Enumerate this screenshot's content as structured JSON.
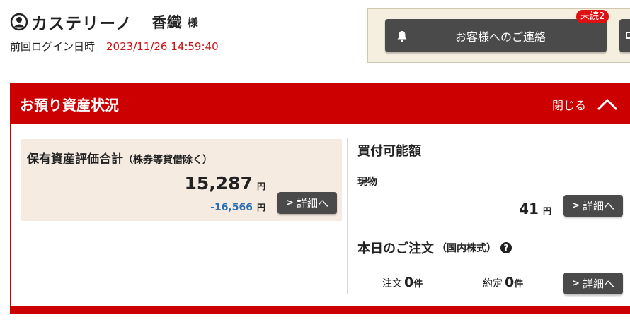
{
  "user": {
    "name": "カステリーノ",
    "given_name": "香織",
    "honorific": "様",
    "last_login_label": "前回ログイン日時",
    "last_login_time": "2023/11/26 14:59:40"
  },
  "contact": {
    "button_label": "お客様へのご連絡",
    "unread_badge": "未読2",
    "icon": "bell-icon"
  },
  "assets": {
    "title": "お預り資産状況",
    "close_label": "閉じる",
    "holdings": {
      "title": "保有資産評価合計",
      "note": "（株券等貸借除く）",
      "value": "15,287",
      "unit": "円",
      "diff": "-16,566",
      "diff_unit": "円",
      "detail_label": "詳細へ"
    },
    "buying_power": {
      "title": "買付可能額",
      "cash_label": "現物",
      "value": "41",
      "unit": "円",
      "detail_label": "詳細へ"
    },
    "orders": {
      "title": "本日のご注文",
      "note": "（国内株式）",
      "order_label": "注文",
      "order_count": "0",
      "order_unit": "件",
      "filled_label": "約定",
      "filled_count": "0",
      "filled_unit": "件",
      "detail_label": "詳細へ"
    }
  },
  "colors": {
    "brand_red": "#cc0000",
    "diff_blue": "#2a6fb3",
    "button_dark": "#4a4a4a",
    "holdings_bg": "#f6ebe1"
  }
}
